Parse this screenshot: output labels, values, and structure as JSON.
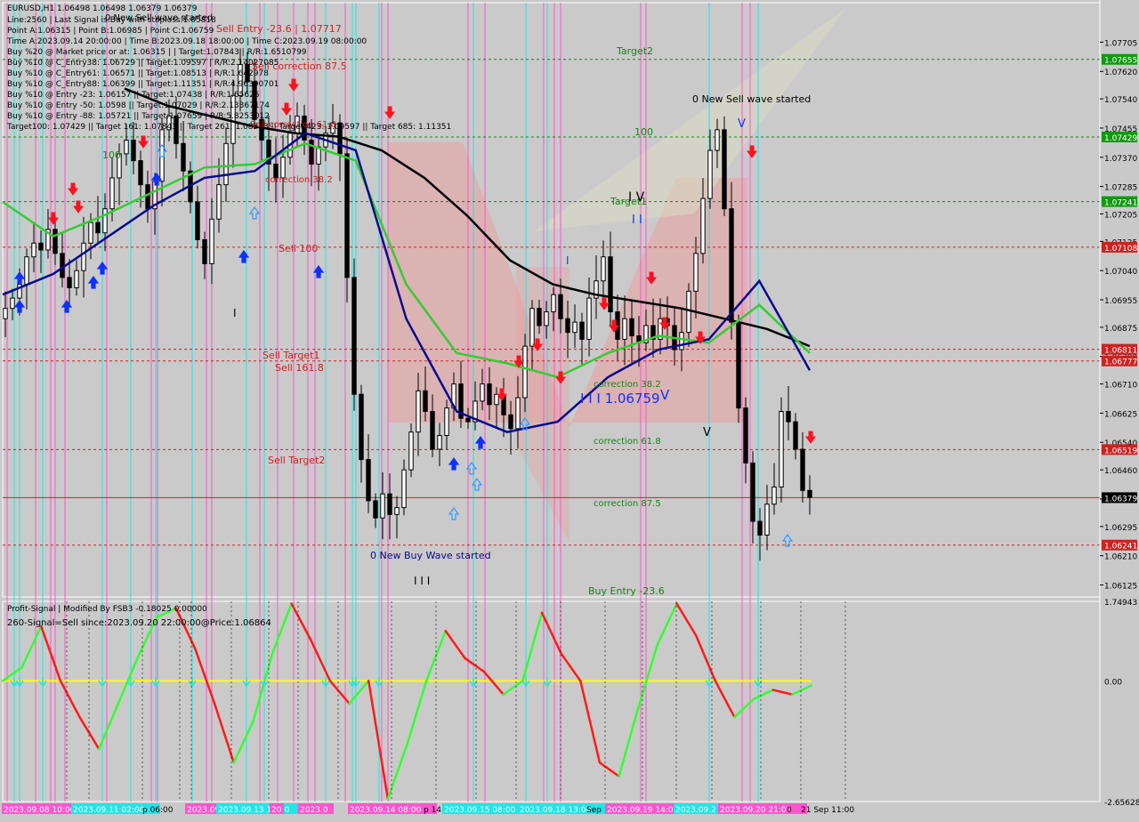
{
  "colors": {
    "background": "#c9c9c9",
    "plot_bg": "#cacaca",
    "panel_border": "#ffffff",
    "bull_candle": "#000000",
    "bear_candle": "#000000",
    "ma_black": "#000000",
    "ma_navy": "#0a0a8c",
    "ma_green": "#33cc33",
    "osc_up": "#33ff33",
    "osc_down": "#ff1a1a",
    "osc_zero": "#ffff00",
    "level_red": "#cc2222",
    "level_green": "#118811",
    "vline_magenta": "#ff55cc",
    "vline_cyan": "#22e5e5",
    "price_box_green": "#119911",
    "price_box_red": "#cc2222",
    "price_box_current": "#000000",
    "arrow_up": "#1030ff",
    "arrow_down": "#ff1020",
    "arrow_up_outline": "#3399ff",
    "zone_red": "#e9a1a1"
  },
  "header": {
    "symbol_line": "EURUSD,H1  1.06498 1.06498 1.06379 1.06379",
    "info_lines": [
      "Line:2560  | Last Signal is:Buy with stoploss:1.05818",
      "Point A:1.06315 | Point B:1.06985 | Point C:1.06759",
      "Time A:2023.09.14 20:00:00 | Time B:2023.09.18 18:00:00 | Time C:2023.09.19 08:00:00",
      "Buy %20 @ Market price or at: 1.06315 | | Target:1.07843 | R/R:1.6510799",
      "Buy %10 @ C_Entry38: 1.06729 || Target:1.09597 | R/R:2.14027085",
      "Buy %10 @ C_Entry61: 1.06571 || Target:1.08513 | R/R:1.642978",
      "Buy %10 @ C_Entry88: 1.06399 || Target:1.11351 | R/R:4.96390701",
      "Buy %10 @ Entry -23: 1.06157 || Target:1.07438 | R/R:1.65625",
      "Buy %10 @ Entry -50: 1.0598 || Target:1.07029 | R/R:2.13367174",
      "Buy %10 @ Entry -88: 1.05721 || Target:1.07659 | R/R:5.8253012",
      "Target100: 1.07429 || Target 161: 1.07843 || Target 261: 1.08513 || Target 423: 1.09597 || Target 685: 1.11351"
    ]
  },
  "annotations": [
    {
      "text": "0 New Sell wave started",
      "color": "#000000"
    },
    {
      "text": "Sell Entry -23.6 | 1.07717",
      "color": "#cc2222"
    },
    {
      "text": "Target2",
      "color": "#118811"
    },
    {
      "text": "0 New Sell wave started",
      "color": "#000000"
    },
    {
      "text": "100",
      "color": "#118811"
    },
    {
      "text": "100",
      "color": "#118811"
    },
    {
      "text": "Target1",
      "color": "#118811"
    },
    {
      "text": "Sell correction 87.5",
      "color": "#cc2222"
    },
    {
      "text": "Sell correction 61.8",
      "color": "#cc2222"
    },
    {
      "text": "correction 38.2",
      "color": "#cc2222"
    },
    {
      "text": "Sell 100",
      "color": "#cc2222"
    },
    {
      "text": "Sell Target1",
      "color": "#cc2222"
    },
    {
      "text": "Sell 161.8",
      "color": "#cc2222"
    },
    {
      "text": "Sell Target2",
      "color": "#cc2222"
    },
    {
      "text": "correction 38.2",
      "color": "#118811"
    },
    {
      "text": "correction 61.8",
      "color": "#118811"
    },
    {
      "text": "correction 87.5",
      "color": "#118811"
    },
    {
      "text": "0 New Buy Wave started",
      "color": "#0a0a8c"
    },
    {
      "text": "Buy Entry -23.6",
      "color": "#118811"
    },
    {
      "text": "I I I 1.06759",
      "color": "#1030ff"
    },
    {
      "text": "V",
      "color": "#1030ff"
    },
    {
      "text": "I V",
      "color": "#000000"
    },
    {
      "text": "I I",
      "color": "#1030ff"
    },
    {
      "text": "I",
      "color": "#1030ff"
    },
    {
      "text": "V",
      "color": "#1030ff"
    },
    {
      "text": "V",
      "color": "#000000"
    },
    {
      "text": "I I I",
      "color": "#000000"
    },
    {
      "text": "I",
      "color": "#000000"
    }
  ],
  "price_boxes": [
    {
      "value": "1.07655",
      "type": "green"
    },
    {
      "value": "1.07429",
      "type": "green"
    },
    {
      "value": "1.07241",
      "type": "green"
    },
    {
      "value": "1.07108",
      "type": "red"
    },
    {
      "value": "1.06811",
      "type": "red"
    },
    {
      "value": "1.06777",
      "type": "red"
    },
    {
      "value": "1.06519",
      "type": "red"
    },
    {
      "value": "1.06379",
      "type": "current"
    },
    {
      "value": "1.06241",
      "type": "red"
    }
  ],
  "indicator": {
    "title": "Profit-Signal | Modified By FSB3 -0.18025 0.00000",
    "signal_text": "260-Signal=Sell since:2023.09.20 22:00:00@Price:1.06864",
    "y_ticks": [
      "1.74943",
      "0.00",
      "-2.65628"
    ]
  },
  "time_axis": {
    "labels": [
      {
        "text": "2023.09.08 10:00",
        "box": "magenta"
      },
      {
        "text": "2023.09.11 02:00",
        "box": "cyan"
      },
      {
        "text": "p 06:00",
        "box": null
      },
      {
        "text": "2023.09.12 0",
        "box": "magenta"
      },
      {
        "text": "2023.09.13 12:00",
        "box": "cyan"
      },
      {
        "text": "20",
        "box": "magenta"
      },
      {
        "text": "2023.0",
        "box": "magenta"
      },
      {
        "text": "2023.09.14 08:00",
        "box": "magenta"
      },
      {
        "text": "p 14",
        "box": null
      },
      {
        "text": "2023.09.15 08:00",
        "box": "cyan"
      },
      {
        "text": "2023.09.18 13:00",
        "box": "cyan"
      },
      {
        "text": "Sep 1",
        "box": null
      },
      {
        "text": "2023.09.19 14:00",
        "box": "magenta"
      },
      {
        "text": "2023.09.2",
        "box": "cyan"
      },
      {
        "text": "2023.09.20 21:00",
        "box": "magenta"
      },
      {
        "text": "0",
        "box": null
      },
      {
        "text": "21 Sep 11:00",
        "box": null
      }
    ]
  },
  "chart_data": {
    "type": "candlestick",
    "symbol": "EURUSD",
    "timeframe": "H1",
    "ylim": [
      1.0609,
      1.0782
    ],
    "y_ticks": [
      "1.07705",
      "1.07620",
      "1.07540",
      "1.07455",
      "1.07370",
      "1.07285",
      "1.07205",
      "1.07125",
      "1.07040",
      "1.06955",
      "1.06875",
      "1.06790",
      "1.06710",
      "1.06625",
      "1.06540",
      "1.06460",
      "1.06375",
      "1.06295",
      "1.06210",
      "1.06125"
    ],
    "levels": [
      {
        "price": 1.07655,
        "color": "green",
        "style": "dashed"
      },
      {
        "price": 1.07429,
        "color": "green",
        "style": "dashed"
      },
      {
        "price": 1.07241,
        "color": "green",
        "style": "dashed"
      },
      {
        "price": 1.07108,
        "color": "red",
        "style": "dashed"
      },
      {
        "price": 1.06811,
        "color": "red",
        "style": "dashed"
      },
      {
        "price": 1.06777,
        "color": "red",
        "style": "dashed"
      },
      {
        "price": 1.06519,
        "color": "red",
        "style": "dashed"
      },
      {
        "price": 1.06379,
        "color": "red",
        "style": "solid"
      },
      {
        "price": 1.06241,
        "color": "red",
        "style": "dashed"
      }
    ],
    "close_path": [
      1.0693,
      1.0696,
      1.07,
      1.0708,
      1.0712,
      1.071,
      1.0716,
      1.0709,
      1.0702,
      1.0699,
      1.0704,
      1.0712,
      1.0718,
      1.0715,
      1.0722,
      1.0731,
      1.0738,
      1.0742,
      1.0736,
      1.0729,
      1.0722,
      1.073,
      1.0745,
      1.0749,
      1.0741,
      1.0733,
      1.0724,
      1.0713,
      1.0706,
      1.0719,
      1.0729,
      1.0741,
      1.0755,
      1.0764,
      1.0759,
      1.0748,
      1.0742,
      1.0735,
      1.0731,
      1.0737,
      1.0744,
      1.0749,
      1.0742,
      1.0735,
      1.074,
      1.0744,
      1.0747,
      1.0738,
      1.0702,
      1.0668,
      1.0649,
      1.0637,
      1.0632,
      1.0639,
      1.0633,
      1.0635,
      1.0646,
      1.0657,
      1.0669,
      1.0663,
      1.0652,
      1.0656,
      1.0664,
      1.0671,
      1.0661,
      1.066,
      1.0666,
      1.0671,
      1.0665,
      1.0668,
      1.0662,
      1.0658,
      1.0667,
      1.0682,
      1.0693,
      1.0688,
      1.0692,
      1.0697,
      1.069,
      1.0686,
      1.0689,
      1.0684,
      1.0696,
      1.0701,
      1.0708,
      1.0692,
      1.0684,
      1.069,
      1.0685,
      1.0683,
      1.0688,
      1.0684,
      1.069,
      1.0688,
      1.0681,
      1.0686,
      1.0698,
      1.0709,
      1.0725,
      1.0739,
      1.0745,
      1.0722,
      1.0689,
      1.0664,
      1.0648,
      1.0631,
      1.0627,
      1.0636,
      1.0641,
      1.0663,
      1.066,
      1.0652,
      1.064,
      1.0638
    ],
    "ma_black": [
      1.0757,
      1.0752,
      1.0749,
      1.0746,
      1.0744,
      1.0743,
      1.0739,
      1.0731,
      1.072,
      1.0707,
      1.07,
      1.0697,
      1.0695,
      1.0693,
      1.069,
      1.0687,
      1.0682
    ],
    "ma_navy": [
      1.0697,
      1.0703,
      1.0713,
      1.0723,
      1.0731,
      1.0733,
      1.0744,
      1.0739,
      1.069,
      1.0663,
      1.0657,
      1.066,
      1.0673,
      1.0681,
      1.0684,
      1.0701,
      1.0675
    ],
    "ma_green": [
      1.0724,
      1.0714,
      1.072,
      1.0727,
      1.0734,
      1.0735,
      1.0741,
      1.0736,
      1.07,
      1.068,
      1.0677,
      1.0673,
      1.068,
      1.0685,
      1.0683,
      1.0694,
      1.068
    ],
    "oscillator": [
      0.0,
      0.3,
      1.2,
      0.0,
      -0.8,
      -1.5,
      -0.5,
      0.5,
      1.4,
      1.6,
      0.7,
      -0.5,
      -1.8,
      -0.9,
      0.6,
      1.7,
      0.9,
      0.0,
      -0.5,
      0.0,
      -2.6,
      -1.4,
      0.0,
      1.1,
      0.5,
      0.2,
      -0.3,
      0.0,
      1.5,
      0.6,
      0.0,
      -1.8,
      -2.1,
      -0.6,
      0.8,
      1.7,
      1.0,
      0.0,
      -0.8,
      -0.4,
      -0.2,
      -0.3,
      -0.1
    ]
  }
}
